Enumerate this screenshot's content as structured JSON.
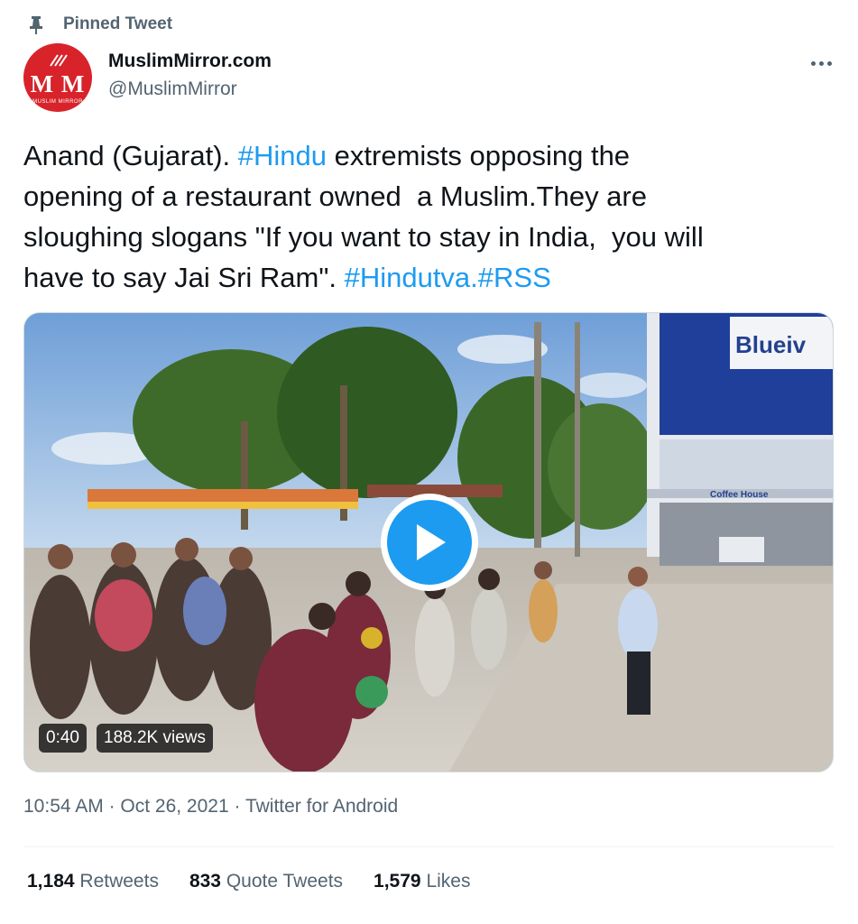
{
  "pinned": {
    "label": "Pinned Tweet",
    "icon": "pin-icon"
  },
  "author": {
    "display_name": "MuslimMirror.com",
    "handle": "@MuslimMirror",
    "avatar_text": "M M",
    "avatar_subtext": "MUSLIM MIRROR",
    "avatar_color": "#d8232a"
  },
  "tweet": {
    "line1_a": "Anand (Gujarat). ",
    "line1_tag": "#Hindu",
    "line1_b": " extremists opposing the",
    "line2": "opening of a restaurant owned  a Muslim.They are",
    "line3": "sloughing slogans \"If you want to stay in India,  you will",
    "line4_a": "have to say Jai Sri Ram\". ",
    "line4_tag1": "#Hindutva",
    "line4_sep": ".",
    "line4_tag2": "#RSS"
  },
  "media": {
    "duration": "0:40",
    "views": "188.2K views",
    "sign_text": "Blueiv",
    "store_text": "Coffee House"
  },
  "meta": {
    "time": "10:54 AM",
    "sep1": " · ",
    "date": "Oct 26, 2021",
    "sep2": " · ",
    "source": "Twitter for Android"
  },
  "stats": {
    "retweets_count": "1,184",
    "retweets_label": "Retweets",
    "quotes_count": "833",
    "quotes_label": "Quote Tweets",
    "likes_count": "1,579",
    "likes_label": "Likes"
  },
  "colors": {
    "link": "#1d9bf0",
    "secondary_text": "#536471",
    "primary_text": "#0f1419"
  }
}
